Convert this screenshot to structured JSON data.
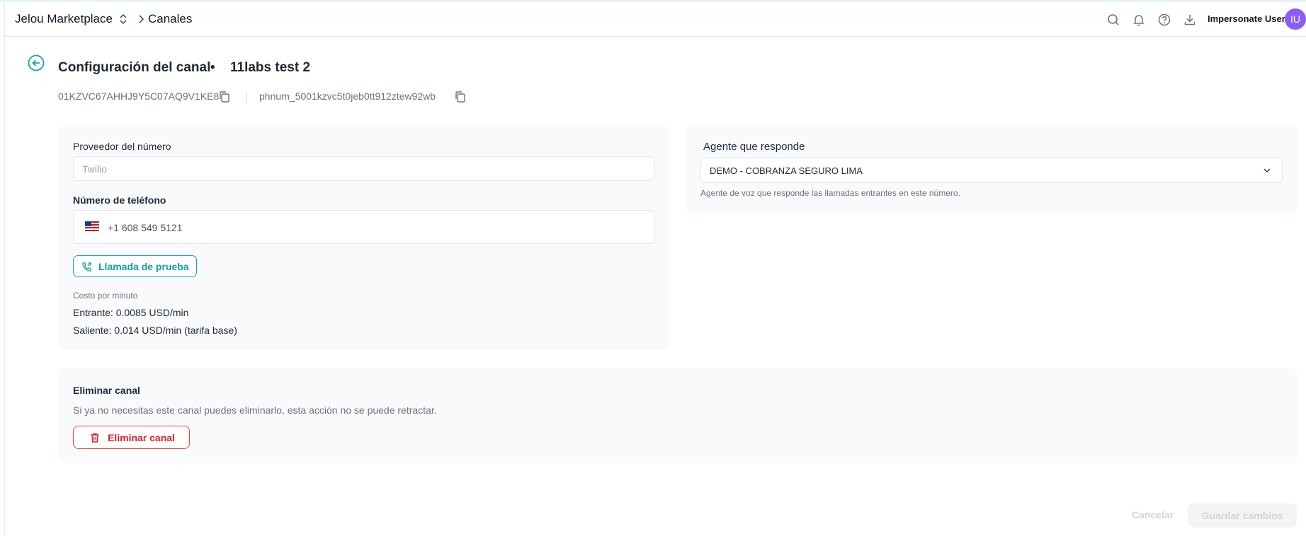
{
  "header": {
    "workspace": "Jelou Marketplace",
    "breadcrumb_page": "Canales",
    "icons": [
      "search-icon",
      "bell-icon",
      "help-icon",
      "download-icon"
    ],
    "user_label": "Impersonate User",
    "avatar_initials": "IU"
  },
  "page": {
    "title": "Configuración del canal",
    "separator": "•",
    "channel_name": "11labs test 2",
    "channel_id": "01KZVC67AHHJ9Y5C07AQ9V1KE8",
    "phone_number_id": "phnum_5001kzvc5t0jeb0tt912ztew92wb"
  },
  "provider": {
    "label": "Proveedor del número",
    "value": "Twilio"
  },
  "phone": {
    "label": "Número de teléfono",
    "value": "+1 608 549 5121",
    "test_call_label": "Llamada de prueba"
  },
  "cost": {
    "label": "Costo por minuto",
    "inbound": "Entrante: 0.0085 USD/min",
    "outbound": "Saliente: 0.014 USD/min (tarifa base)"
  },
  "agent": {
    "label": "Agente que responde",
    "selected": "DEMO - COBRANZA SEGURO LIMA",
    "help": "Agente de voz que responde las llamadas entrantes en este número."
  },
  "delete": {
    "title": "Eliminar canal",
    "description": "Si ya no necesitas este canal puedes eliminarlo, esta acción no se puede retractar.",
    "button": "Eliminar canal"
  },
  "footer": {
    "cancel": "Cancelar",
    "save": "Guardar cambios"
  },
  "colors": {
    "accent": "#14a3ad",
    "danger": "#ef4444",
    "avatar": "#8b5cf6"
  }
}
